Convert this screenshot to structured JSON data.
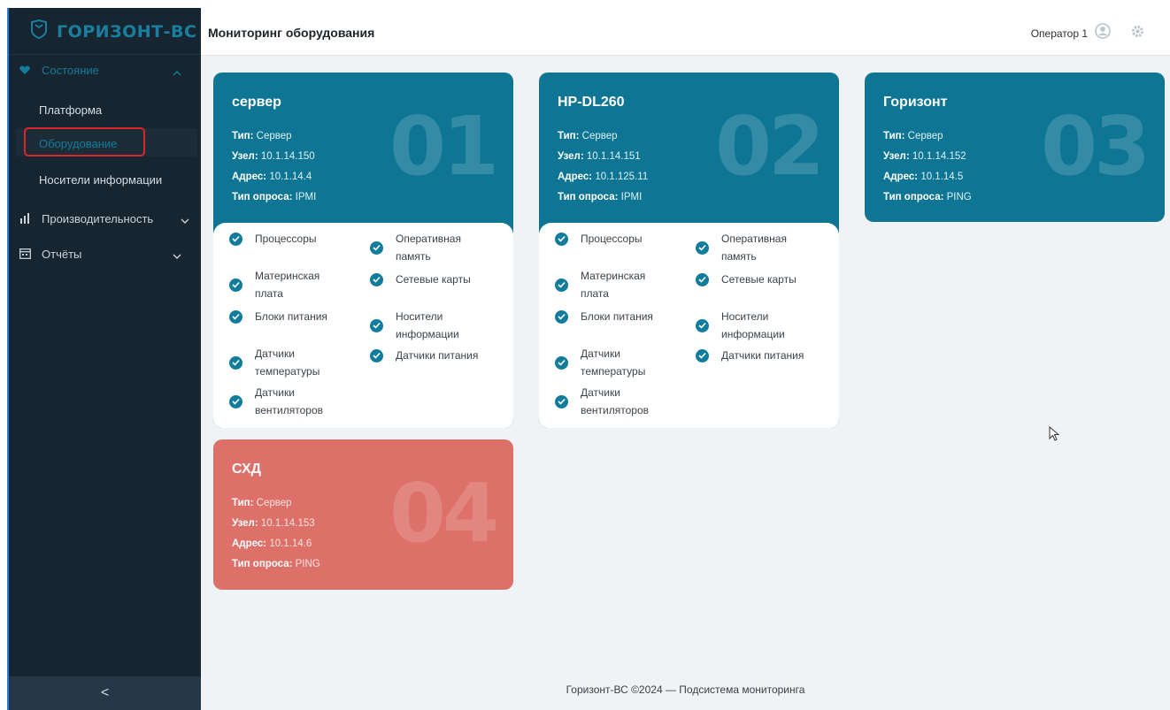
{
  "app": {
    "logo_text": "ГОРИЗОНТ-ВС"
  },
  "sidebar": {
    "section_state": "Состояние",
    "items": [
      "Платформа",
      "Оборудование",
      "Носители информации"
    ],
    "section_perf": "Производительность",
    "section_reports": "Отчёты",
    "collapse_label": "<"
  },
  "header": {
    "title": "Мониторинг оборудования",
    "user": "Оператор 1"
  },
  "labels": {
    "type": "Тип:",
    "node": "Узел:",
    "address": "Адрес:",
    "poll": "Тип опроса:"
  },
  "cards": [
    {
      "name": "сервер",
      "num": "01",
      "type": "Сервер",
      "node": "10.1.14.150",
      "address": "10.1.14.4",
      "poll": "IPMI",
      "color": "#0e7594"
    },
    {
      "name": "HP-DL260",
      "num": "02",
      "type": "Сервер",
      "node": "10.1.14.151",
      "address": "10.1.125.11",
      "poll": "IPMI",
      "color": "#0e7594"
    },
    {
      "name": "Горизонт",
      "num": "03",
      "type": "Сервер",
      "node": "10.1.14.152",
      "address": "10.1.14.5",
      "poll": "PING",
      "color": "#0e7594"
    },
    {
      "name": "СХД",
      "num": "04",
      "type": "Сервер",
      "node": "10.1.14.153",
      "address": "10.1.14.6",
      "poll": "PING",
      "color": "#dd7068"
    }
  ],
  "checks_left": [
    "Процессоры",
    "Материнская плата",
    "Блоки питания",
    "Датчики температуры",
    "Датчики вентиляторов"
  ],
  "checks_right": [
    "Оперативная память",
    "Сетевые карты",
    "Носители информации",
    "Датчики питания"
  ],
  "footer": "Горизонт-ВС ©2024 — Подсистема мониторинга"
}
